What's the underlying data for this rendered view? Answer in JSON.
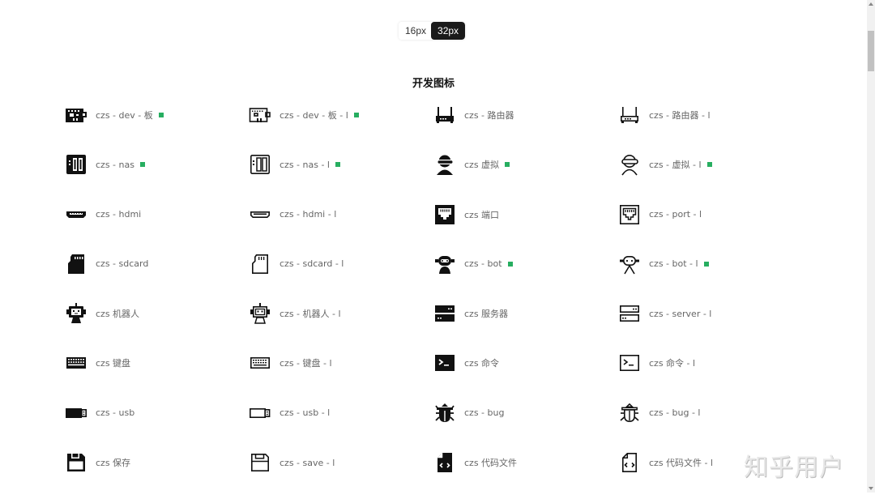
{
  "size_toggle": {
    "options": [
      {
        "label": "16px",
        "active": false
      },
      {
        "label": "32px",
        "active": true
      }
    ]
  },
  "section": {
    "title": "开发图标"
  },
  "colors": {
    "badge": "#27ae60",
    "active_toggle": "#1a1a1a"
  },
  "icons": [
    [
      {
        "icon": "dev-board-filled-icon",
        "label": "czs - dev - 板",
        "badge": true
      },
      {
        "icon": "dev-board-outline-icon",
        "label": "czs - dev - 板 - l",
        "badge": true
      },
      {
        "icon": "router-filled-icon",
        "label": "czs - 路由器",
        "badge": false
      },
      {
        "icon": "router-outline-icon",
        "label": "czs - 路由器 - l",
        "badge": false
      }
    ],
    [
      {
        "icon": "nas-filled-icon",
        "label": "czs - nas",
        "badge": true
      },
      {
        "icon": "nas-outline-icon",
        "label": "czs - nas - l",
        "badge": true
      },
      {
        "icon": "vr-filled-icon",
        "label": "czs 虚拟",
        "badge": true
      },
      {
        "icon": "vr-outline-icon",
        "label": "czs - 虚拟 - l",
        "badge": true
      }
    ],
    [
      {
        "icon": "hdmi-filled-icon",
        "label": "czs - hdmi",
        "badge": false
      },
      {
        "icon": "hdmi-outline-icon",
        "label": "czs - hdmi - l",
        "badge": false
      },
      {
        "icon": "port-filled-icon",
        "label": "czs 端口",
        "badge": false
      },
      {
        "icon": "port-outline-icon",
        "label": "czs - port - l",
        "badge": false
      }
    ],
    [
      {
        "icon": "sdcard-filled-icon",
        "label": "czs - sdcard",
        "badge": false
      },
      {
        "icon": "sdcard-outline-icon",
        "label": "czs - sdcard - l",
        "badge": false
      },
      {
        "icon": "bot-filled-icon",
        "label": "czs - bot",
        "badge": true
      },
      {
        "icon": "bot-outline-icon",
        "label": "czs - bot - l",
        "badge": true
      }
    ],
    [
      {
        "icon": "robot-filled-icon",
        "label": "czs 机器人",
        "badge": false
      },
      {
        "icon": "robot-outline-icon",
        "label": "czs - 机器人 - l",
        "badge": false
      },
      {
        "icon": "server-filled-icon",
        "label": "czs 服务器",
        "badge": false
      },
      {
        "icon": "server-outline-icon",
        "label": "czs - server - l",
        "badge": false
      }
    ],
    [
      {
        "icon": "keyboard-filled-icon",
        "label": "czs 键盘",
        "badge": false
      },
      {
        "icon": "keyboard-outline-icon",
        "label": "czs - 键盘 - l",
        "badge": false
      },
      {
        "icon": "terminal-filled-icon",
        "label": "czs 命令",
        "badge": false
      },
      {
        "icon": "terminal-outline-icon",
        "label": "czs 命令 - l",
        "badge": false
      }
    ],
    [
      {
        "icon": "usb-filled-icon",
        "label": "czs - usb",
        "badge": false
      },
      {
        "icon": "usb-outline-icon",
        "label": "czs - usb - l",
        "badge": false
      },
      {
        "icon": "bug-filled-icon",
        "label": "czs - bug",
        "badge": false
      },
      {
        "icon": "bug-outline-icon",
        "label": "czs - bug - l",
        "badge": false
      }
    ],
    [
      {
        "icon": "save-filled-icon",
        "label": "czs 保存",
        "badge": false
      },
      {
        "icon": "save-outline-icon",
        "label": "czs - save - l",
        "badge": false
      },
      {
        "icon": "code-file-filled-icon",
        "label": "czs 代码文件",
        "badge": false
      },
      {
        "icon": "code-file-outline-icon",
        "label": "czs 代码文件 - l",
        "badge": false
      }
    ]
  ],
  "watermark": "知乎用户"
}
